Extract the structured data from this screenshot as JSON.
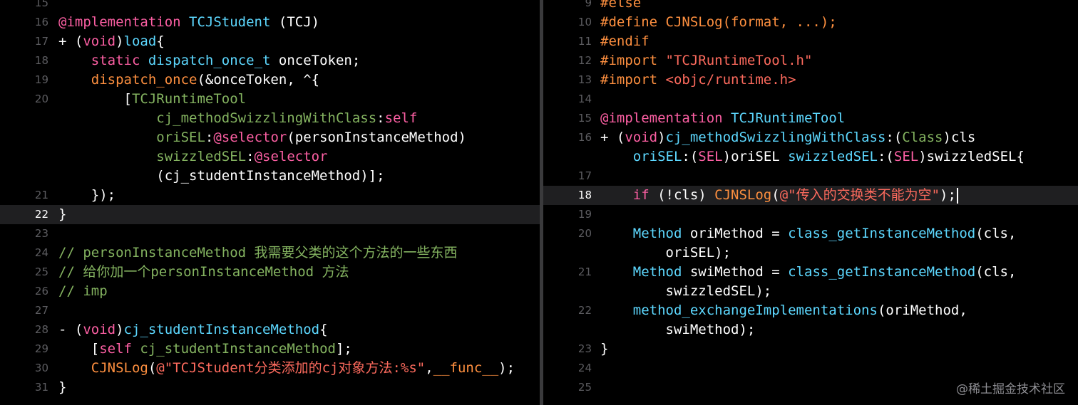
{
  "colors": {
    "plain": "#ffffff",
    "keyword": "#fc5fa3",
    "type": "#5dd8ff",
    "classname": "#41a1c0",
    "method": "#67b7a4",
    "string": "#fc6a5d",
    "number": "#d0bf69",
    "comment": "#6c7986",
    "preproc": "#fd8f3f",
    "greencomment": "#84b360",
    "macro": "#fd8f3f",
    "tealfunc": "#67b7a4",
    "lightblue": "#5dd8ff",
    "purple": "#d0a8ff",
    "orange": "#fd8f3f"
  },
  "watermark": "@稀土掘金技术社区",
  "left_editor": {
    "lines": [
      {
        "num": "15",
        "tokens": []
      },
      {
        "num": "16",
        "tokens": [
          [
            "@implementation",
            "#fc5fa3"
          ],
          [
            " ",
            "#ffffff"
          ],
          [
            "TCJStudent",
            "#5dd8ff"
          ],
          [
            " (TCJ)",
            "#ffffff"
          ]
        ]
      },
      {
        "num": "17",
        "tokens": [
          [
            "+ (",
            "#ffffff"
          ],
          [
            "void",
            "#fc5fa3"
          ],
          [
            ")",
            "#ffffff"
          ],
          [
            "load",
            "#5dd8ff"
          ],
          [
            "{",
            "#ffffff"
          ]
        ]
      },
      {
        "num": "18",
        "tokens": [
          [
            "    ",
            "#ffffff"
          ],
          [
            "static",
            "#fc5fa3"
          ],
          [
            " ",
            "#ffffff"
          ],
          [
            "dispatch_once_t",
            "#5dd8ff"
          ],
          [
            " onceToken;",
            "#ffffff"
          ]
        ]
      },
      {
        "num": "19",
        "tokens": [
          [
            "    ",
            "#ffffff"
          ],
          [
            "dispatch_once",
            "#fd8f3f"
          ],
          [
            "(&onceToken, ^{",
            "#ffffff"
          ]
        ]
      },
      {
        "num": "20",
        "tokens": [
          [
            "        [",
            "#ffffff"
          ],
          [
            "TCJRuntimeTool",
            "#84b360"
          ]
        ]
      },
      {
        "num": "",
        "tokens": [
          [
            "            ",
            "#ffffff"
          ],
          [
            "cj_methodSwizzlingWithClass",
            "#84b360"
          ],
          [
            ":",
            "#ffffff"
          ],
          [
            "self",
            "#fc5fa3"
          ]
        ]
      },
      {
        "num": "",
        "tokens": [
          [
            "            ",
            "#ffffff"
          ],
          [
            "oriSEL",
            "#84b360"
          ],
          [
            ":",
            "#ffffff"
          ],
          [
            "@selector",
            "#fc5fa3"
          ],
          [
            "(personInstanceMethod)",
            "#ffffff"
          ]
        ]
      },
      {
        "num": "",
        "tokens": [
          [
            "            ",
            "#ffffff"
          ],
          [
            "swizzledSEL",
            "#84b360"
          ],
          [
            ":",
            "#ffffff"
          ],
          [
            "@selector",
            "#fc5fa3"
          ]
        ]
      },
      {
        "num": "",
        "tokens": [
          [
            "            (cj_studentInstanceMethod)];",
            "#ffffff"
          ]
        ]
      },
      {
        "num": "21",
        "tokens": [
          [
            "    });",
            "#ffffff"
          ]
        ]
      },
      {
        "num": "22",
        "hl": true,
        "tokens": [
          [
            "}",
            "#ffffff"
          ]
        ]
      },
      {
        "num": "23",
        "tokens": []
      },
      {
        "num": "24",
        "tokens": [
          [
            "// personInstanceMethod 我需要父类的这个方法的一些东西",
            "#84b360"
          ]
        ]
      },
      {
        "num": "25",
        "tokens": [
          [
            "// 给你加一个personInstanceMethod 方法",
            "#84b360"
          ]
        ]
      },
      {
        "num": "26",
        "tokens": [
          [
            "// imp",
            "#84b360"
          ]
        ]
      },
      {
        "num": "27",
        "tokens": []
      },
      {
        "num": "28",
        "tokens": [
          [
            "- (",
            "#ffffff"
          ],
          [
            "void",
            "#fc5fa3"
          ],
          [
            ")",
            "#ffffff"
          ],
          [
            "cj_studentInstanceMethod",
            "#5dd8ff"
          ],
          [
            "{",
            "#ffffff"
          ]
        ]
      },
      {
        "num": "29",
        "tokens": [
          [
            "    [",
            "#ffffff"
          ],
          [
            "self",
            "#fc5fa3"
          ],
          [
            " ",
            "#ffffff"
          ],
          [
            "cj_studentInstanceMethod",
            "#84b360"
          ],
          [
            "];",
            "#ffffff"
          ]
        ]
      },
      {
        "num": "30",
        "tokens": [
          [
            "    ",
            "#ffffff"
          ],
          [
            "CJNSLog",
            "#fd8f3f"
          ],
          [
            "(",
            "#ffffff"
          ],
          [
            "@\"TCJStudent分类添加的cj对象方法:%s\"",
            "#fc6a5d"
          ],
          [
            ",",
            "#ffffff"
          ],
          [
            "__func__",
            "#fd8f3f"
          ],
          [
            ");",
            "#ffffff"
          ]
        ]
      },
      {
        "num": "31",
        "tokens": [
          [
            "}",
            "#ffffff"
          ]
        ]
      }
    ]
  },
  "right_editor": {
    "lines": [
      {
        "num": "9",
        "tokens": [
          [
            "#else",
            "#fd8f3f"
          ]
        ]
      },
      {
        "num": "10",
        "tokens": [
          [
            "#define",
            "#fd8f3f"
          ],
          [
            " ",
            "#ffffff"
          ],
          [
            "CJNSLog(format, ...);",
            "#fd8f3f"
          ]
        ]
      },
      {
        "num": "11",
        "tokens": [
          [
            "#endif",
            "#fd8f3f"
          ]
        ]
      },
      {
        "num": "12",
        "tokens": [
          [
            "#import",
            "#fd8f3f"
          ],
          [
            " ",
            "#ffffff"
          ],
          [
            "\"TCJRuntimeTool.h\"",
            "#fc6a5d"
          ]
        ]
      },
      {
        "num": "13",
        "tokens": [
          [
            "#import",
            "#fd8f3f"
          ],
          [
            " ",
            "#ffffff"
          ],
          [
            "<objc/runtime.h>",
            "#fc6a5d"
          ]
        ]
      },
      {
        "num": "14",
        "tokens": []
      },
      {
        "num": "15",
        "tokens": [
          [
            "@implementation",
            "#fc5fa3"
          ],
          [
            " ",
            "#ffffff"
          ],
          [
            "TCJRuntimeTool",
            "#5dd8ff"
          ]
        ]
      },
      {
        "num": "16",
        "tokens": [
          [
            "+ (",
            "#ffffff"
          ],
          [
            "void",
            "#fc5fa3"
          ],
          [
            ")",
            "#ffffff"
          ],
          [
            "cj_methodSwizzlingWithClass",
            "#5dd8ff"
          ],
          [
            ":(",
            "#ffffff"
          ],
          [
            "Class",
            "#84b360"
          ],
          [
            ")cls",
            "#ffffff"
          ]
        ]
      },
      {
        "num": "",
        "tokens": [
          [
            "    ",
            "#ffffff"
          ],
          [
            "oriSEL",
            "#5dd8ff"
          ],
          [
            ":(",
            "#ffffff"
          ],
          [
            "SEL",
            "#fc5fa3"
          ],
          [
            ")oriSEL ",
            "#ffffff"
          ],
          [
            "swizzledSEL",
            "#5dd8ff"
          ],
          [
            ":(",
            "#ffffff"
          ],
          [
            "SEL",
            "#fc5fa3"
          ],
          [
            ")swizzledSEL{",
            "#ffffff"
          ]
        ]
      },
      {
        "num": "17",
        "tokens": []
      },
      {
        "num": "18",
        "hl": true,
        "caret": true,
        "tokens": [
          [
            "    ",
            "#ffffff"
          ],
          [
            "if",
            "#fc5fa3"
          ],
          [
            " (!cls) ",
            "#ffffff"
          ],
          [
            "CJNSLog",
            "#fd8f3f"
          ],
          [
            "(",
            "#ffffff"
          ],
          [
            "@\"传入的交换类不能为空\"",
            "#fc6a5d"
          ],
          [
            ");",
            "#ffffff"
          ]
        ]
      },
      {
        "num": "19",
        "tokens": []
      },
      {
        "num": "20",
        "tokens": [
          [
            "    ",
            "#ffffff"
          ],
          [
            "Method",
            "#5dd8ff"
          ],
          [
            " oriMethod = ",
            "#ffffff"
          ],
          [
            "class_getInstanceMethod",
            "#5dd8ff"
          ],
          [
            "(cls,",
            "#ffffff"
          ]
        ]
      },
      {
        "num": "",
        "tokens": [
          [
            "        oriSEL);",
            "#ffffff"
          ]
        ]
      },
      {
        "num": "21",
        "tokens": [
          [
            "    ",
            "#ffffff"
          ],
          [
            "Method",
            "#5dd8ff"
          ],
          [
            " swiMethod = ",
            "#ffffff"
          ],
          [
            "class_getInstanceMethod",
            "#5dd8ff"
          ],
          [
            "(cls,",
            "#ffffff"
          ]
        ]
      },
      {
        "num": "",
        "tokens": [
          [
            "        swizzledSEL);",
            "#ffffff"
          ]
        ]
      },
      {
        "num": "22",
        "tokens": [
          [
            "    ",
            "#ffffff"
          ],
          [
            "method_exchangeImplementations",
            "#5dd8ff"
          ],
          [
            "(oriMethod,",
            "#ffffff"
          ]
        ]
      },
      {
        "num": "",
        "tokens": [
          [
            "        swiMethod);",
            "#ffffff"
          ]
        ]
      },
      {
        "num": "23",
        "tokens": [
          [
            "}",
            "#ffffff"
          ]
        ]
      },
      {
        "num": "24",
        "tokens": []
      },
      {
        "num": "25",
        "tokens": []
      }
    ]
  }
}
